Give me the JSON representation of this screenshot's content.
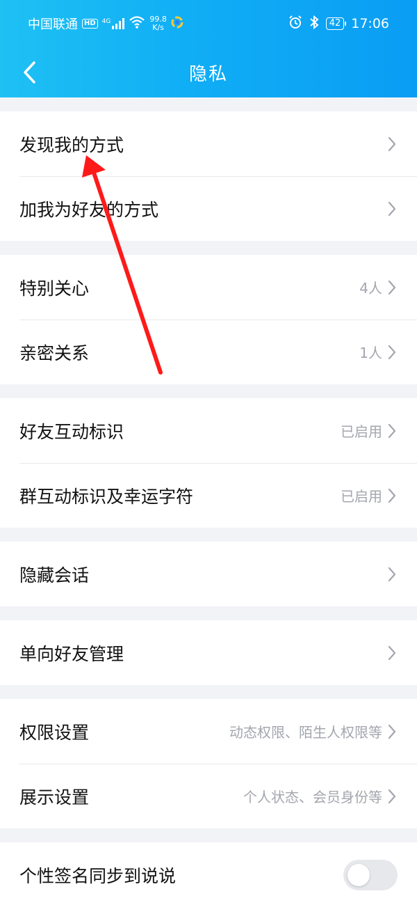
{
  "statusbar": {
    "carrier": "中国联通",
    "hd": "HD",
    "signal_type": "4G",
    "speed_value": "99.8",
    "speed_unit": "K/s",
    "battery": "42",
    "time": "17:06"
  },
  "header": {
    "title": "隐私"
  },
  "groups": [
    {
      "rows": [
        {
          "label": "发现我的方式",
          "value": ""
        },
        {
          "label": "加我为好友的方式",
          "value": ""
        }
      ]
    },
    {
      "rows": [
        {
          "label": "特别关心",
          "value": "4人"
        },
        {
          "label": "亲密关系",
          "value": "1人"
        }
      ]
    },
    {
      "rows": [
        {
          "label": "好友互动标识",
          "value": "已启用"
        },
        {
          "label": "群互动标识及幸运字符",
          "value": "已启用"
        }
      ]
    },
    {
      "rows": [
        {
          "label": "隐藏会话",
          "value": ""
        }
      ]
    },
    {
      "rows": [
        {
          "label": "单向好友管理",
          "value": ""
        }
      ]
    },
    {
      "rows": [
        {
          "label": "权限设置",
          "value": "动态权限、陌生人权限等"
        },
        {
          "label": "展示设置",
          "value": "个人状态、会员身份等"
        }
      ]
    },
    {
      "rows": [
        {
          "label": "个性签名同步到说说",
          "toggle_on": false
        }
      ]
    }
  ],
  "colors": {
    "header_start": "#1ec1f4",
    "header_end": "#0a9df4",
    "annotation_arrow": "#ff1a1a",
    "chevron": "#a3a6ad"
  }
}
